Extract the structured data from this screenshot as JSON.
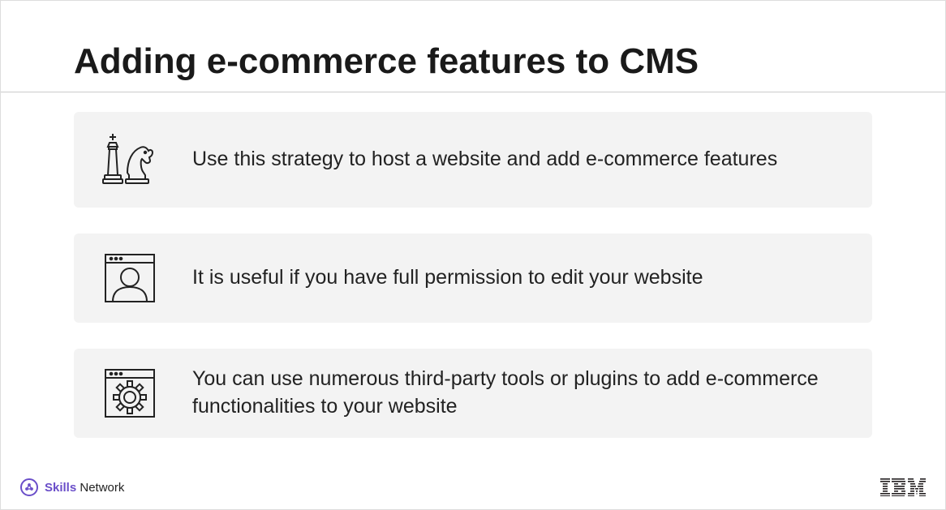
{
  "title": "Adding e-commerce features to CMS",
  "rows": [
    {
      "icon": "chess-pieces-icon",
      "text": "Use this strategy to host a website and add e-commerce features"
    },
    {
      "icon": "user-window-icon",
      "text": "It is useful if you have full permission to edit your website"
    },
    {
      "icon": "gear-window-icon",
      "text": "You can use numerous third-party tools or plugins to add e-commerce functionalities to your website"
    }
  ],
  "footer": {
    "skills_bold": "Skills",
    "skills_light": " Network",
    "logo": "IBM"
  }
}
